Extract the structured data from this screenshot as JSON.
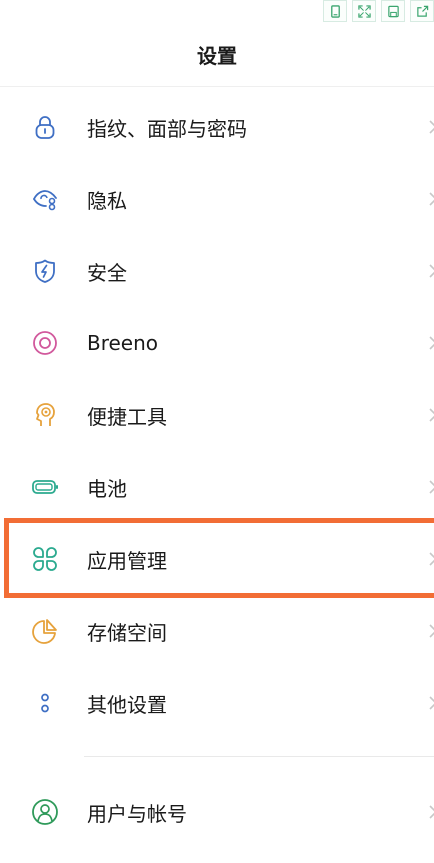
{
  "header": {
    "title": "设置"
  },
  "toolbar": {
    "buttons": [
      {
        "icon": "phone-portrait-icon",
        "color": "#3aa56e"
      },
      {
        "icon": "fullscreen-icon",
        "color": "#3aa56e"
      },
      {
        "icon": "save-icon",
        "color": "#3aa56e"
      },
      {
        "icon": "share-icon",
        "color": "#3aa56e"
      }
    ]
  },
  "menu": {
    "items": [
      {
        "id": "fingerprint-face-password",
        "label": "指纹、面部与密码",
        "icon": "lock-icon",
        "color": "#3f6fc4"
      },
      {
        "id": "privacy",
        "label": "隐私",
        "icon": "privacy-eye-icon",
        "color": "#3f6fc4"
      },
      {
        "id": "security",
        "label": "安全",
        "icon": "shield-bolt-icon",
        "color": "#3f6fc4"
      },
      {
        "id": "breeno",
        "label": "Breeno",
        "icon": "breeno-ring-icon",
        "color": "#d1589c"
      },
      {
        "id": "convenience-tools",
        "label": "便捷工具",
        "icon": "head-bulb-icon",
        "color": "#e6a23c"
      },
      {
        "id": "battery",
        "label": "电池",
        "icon": "battery-icon",
        "color": "#2baa8f"
      },
      {
        "id": "app-management",
        "label": "应用管理",
        "icon": "clover-grid-icon",
        "color": "#2baa8f"
      },
      {
        "id": "storage",
        "label": "存储空间",
        "icon": "pie-chart-icon",
        "color": "#e6a23c"
      },
      {
        "id": "other-settings",
        "label": "其他设置",
        "icon": "dots-vertical-icon",
        "color": "#3f6fc4"
      },
      {
        "id": "users-accounts",
        "label": "用户与帐号",
        "icon": "user-circle-icon",
        "color": "#2f9a5a"
      }
    ]
  },
  "highlight": {
    "target": "app-management",
    "color": "#f26d35"
  }
}
